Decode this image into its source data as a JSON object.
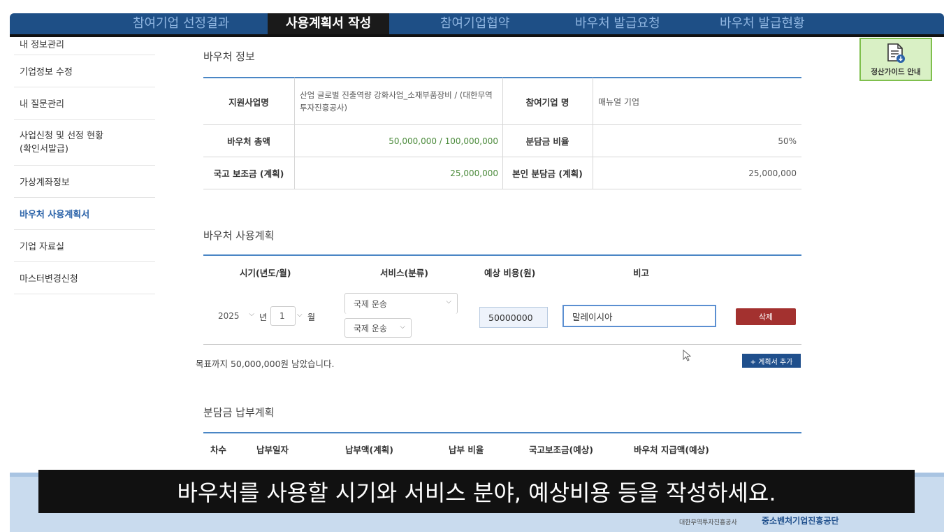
{
  "tabs": [
    {
      "label": "참여기업 선정결과"
    },
    {
      "label": "사용계획서 작성"
    },
    {
      "label": "참여기업협약"
    },
    {
      "label": "바우처 발급요청"
    },
    {
      "label": "바우처 발급현황"
    }
  ],
  "sidebar": {
    "items": [
      {
        "label": "내 정보관리"
      },
      {
        "label": "기업정보 수정"
      },
      {
        "label": "내 질문관리"
      },
      {
        "label": "사업신청 및 선정 현황\n(확인서발급)"
      },
      {
        "label": "가상계좌정보"
      },
      {
        "label": "바우처 사용계획서"
      },
      {
        "label": "기업 자료실"
      },
      {
        "label": "마스터변경신청"
      }
    ]
  },
  "guide_button": {
    "label": "정산가이드 안내"
  },
  "voucher_info": {
    "title": "바우처 정보",
    "labels": {
      "support_program": "지원사업명",
      "company_name": "참여기업 명",
      "total": "바우처 총액",
      "share_ratio": "분담금 비율",
      "subsidy": "국고 보조금 (계획)",
      "own_share": "본인 분담금 (계획)"
    },
    "values": {
      "support_program": "산업 글로벌 진출역량 강화사업_소재부품장비 / (대한무역투자진흥공사)",
      "company_name": "매뉴얼 기업",
      "total": "50,000,000 / 100,000,000",
      "share_ratio": "50%",
      "subsidy": "25,000,000",
      "own_share": "25,000,000"
    }
  },
  "usage_plan": {
    "title": "바우처 사용계획",
    "headers": [
      "시기(년도/월)",
      "서비스(분류)",
      "예상 비용(원)",
      "비고"
    ],
    "row": {
      "year": "2025",
      "year_unit": "년",
      "month": "1",
      "month_unit": "월",
      "service_main": "국제 운송",
      "service_sub": "국제 운송",
      "cost": "50000000",
      "note": "말레이시아",
      "delete_label": "삭제"
    },
    "remaining_text": "목표까지 50,000,000원 남았습니다.",
    "add_label": "+ 계획서 추가"
  },
  "payment_plan": {
    "title": "분담금 납부계획",
    "headers": [
      "차수",
      "납부일자",
      "납부액(계획)",
      "납부 비율",
      "국고보조금(예상)",
      "바우처 지급액(예상)"
    ]
  },
  "caption": "바우처를 사용할 시기와 서비스 분야, 예상비용 등을 작성하세요.",
  "footer": {
    "org_small": "대한무역투자진흥공사",
    "org_main": "중소벤처기업진흥공단"
  },
  "colors": {
    "tabbar": "#1e4f86",
    "accent": "#4a86c5",
    "delete": "#a3312f",
    "guide_bg": "#d9f0c5"
  }
}
